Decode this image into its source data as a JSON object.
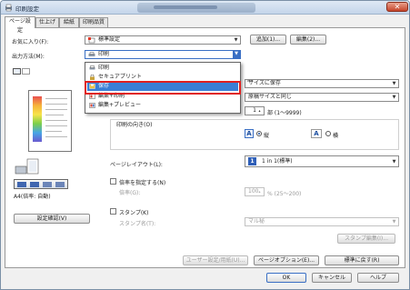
{
  "window": {
    "title": "印刷設定",
    "close_glyph": "✕"
  },
  "tabs": [
    "ページ設定",
    "仕上げ",
    "給紙",
    "印刷品質"
  ],
  "favorites": {
    "label": "お気に入り(F):",
    "value": "標準設定",
    "add_button": "追加(1)...",
    "edit_button": "編集(2)..."
  },
  "output_method": {
    "label": "出力方法(M):",
    "value": "印刷",
    "options": [
      "印刷",
      "セキュアプリント",
      "保存",
      "編集+印刷",
      "編集+プレビュー"
    ],
    "selected_index": 2
  },
  "paper_size": {
    "value_partial": "サイズに保存",
    "value_partial_prefix": "A4"
  },
  "output_size": {
    "value": "原稿サイズと同じ"
  },
  "copies": {
    "value": "1",
    "unit": "部 (1〜9999)"
  },
  "orientation": {
    "label": "印刷の向き(O)",
    "portrait": "縦",
    "landscape": "横",
    "icon_letter": "A"
  },
  "page_layout": {
    "label": "ページレイアウト(L):",
    "value": "1 in 1(標準)",
    "badge": "1"
  },
  "scaling": {
    "checkbox_label": "倍率を指定する(N)",
    "sub_label": "倍率(G):",
    "value": "100",
    "range": "% (25〜200)"
  },
  "stamp": {
    "checkbox_label": "スタンプ(K)",
    "sub_label": "スタンプ名(T):",
    "value": "マル秘",
    "edit_button": "スタンプ編集(I)..."
  },
  "preview": {
    "caption": "A4(倍率: 自動)",
    "settings_button": "設定確認(V)"
  },
  "bottom_buttons": {
    "user_settings": "ユーザー設定/用紙(U)...",
    "page_options": "ページオプション(E)...",
    "restore": "標準に戻す(R)"
  },
  "dialog_buttons": {
    "ok": "OK",
    "cancel": "キャンセル",
    "help": "ヘルプ"
  },
  "colors": {
    "selection": "#3a7fd6",
    "highlight_box": "#e02020",
    "accent_blue": "#1d4fa0"
  }
}
